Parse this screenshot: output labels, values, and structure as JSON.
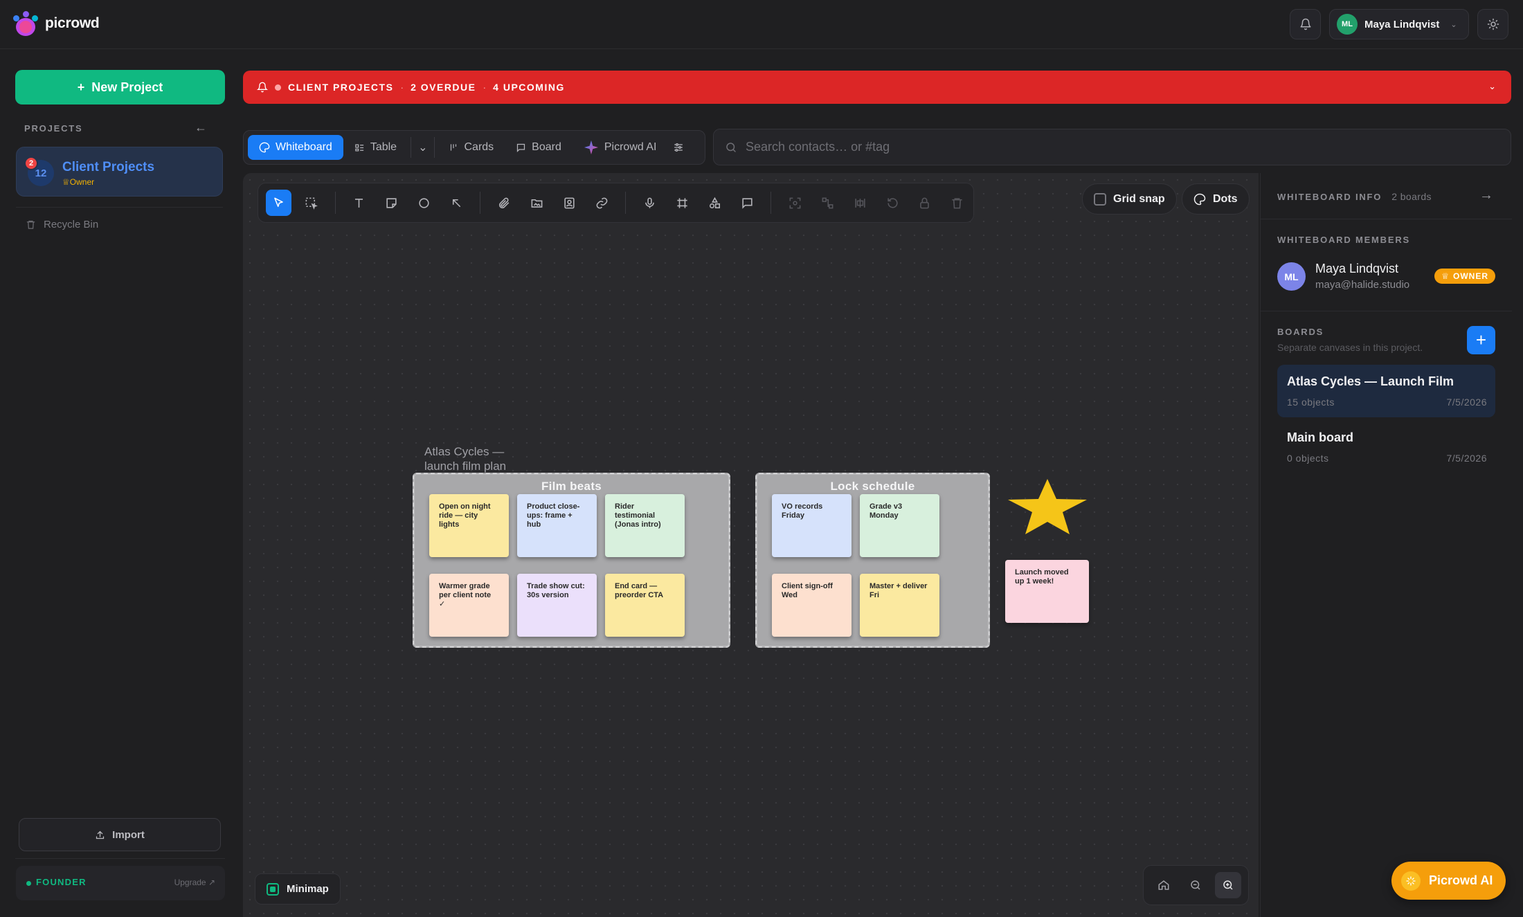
{
  "app": {
    "name": "picrowd"
  },
  "header": {
    "user_initials": "ML",
    "user_name": "Maya Lindqvist"
  },
  "sidebar": {
    "new_project_label": "New Project",
    "projects_label": "PROJECTS",
    "project": {
      "name": "Client Projects",
      "role": "Owner",
      "count": "12",
      "badge": "2"
    },
    "recycle_label": "Recycle Bin",
    "import_label": "Import",
    "plan_label": "FOUNDER",
    "upgrade_label": "Upgrade ↗"
  },
  "alert": {
    "project": "CLIENT PROJECTS",
    "overdue": "2 OVERDUE",
    "upcoming": "4 UPCOMING"
  },
  "views": {
    "tabs": [
      "Whiteboard",
      "Table",
      "Cards",
      "Board",
      "Picrowd AI"
    ],
    "active": "Whiteboard"
  },
  "search": {
    "placeholder": "Search contacts… or #tag"
  },
  "canvas": {
    "grid_snap_label": "Grid snap",
    "dots_label": "Dots",
    "minimap_label": "Minimap",
    "board_title": "Atlas Cycles — launch film plan",
    "frames": [
      {
        "title": "Film beats",
        "notes": [
          {
            "text": "Open on night ride — city lights",
            "color": "#fbe9a0"
          },
          {
            "text": "Product close-ups: frame + hub",
            "color": "#d6e2fb"
          },
          {
            "text": "Rider testimonial (Jonas intro)",
            "color": "#d8f0dd"
          },
          {
            "text": "Warmer grade per client note ✓",
            "color": "#fde0cf"
          },
          {
            "text": "Trade show cut: 30s version",
            "color": "#ebe0fb"
          },
          {
            "text": "End card — preorder CTA",
            "color": "#fbe9a0"
          }
        ]
      },
      {
        "title": "Lock schedule",
        "notes": [
          {
            "text": "VO records Friday",
            "color": "#d6e2fb"
          },
          {
            "text": "Grade v3 Monday",
            "color": "#d8f0dd"
          },
          {
            "text": "Client sign-off Wed",
            "color": "#fde0cf"
          },
          {
            "text": "Master + deliver Fri",
            "color": "#fbe9a0"
          }
        ]
      }
    ],
    "loose_note": {
      "text": "Launch moved up 1 week!",
      "color": "#fbd5df"
    },
    "star_color": "#f5c518"
  },
  "panel": {
    "info_label": "WHITEBOARD INFO",
    "info_count": "2 boards",
    "members_label": "WHITEBOARD MEMBERS",
    "member": {
      "initials": "ML",
      "name": "Maya Lindqvist",
      "email": "maya@halide.studio",
      "role": "OWNER"
    },
    "boards_label": "BOARDS",
    "boards_sub": "Separate canvases in this project.",
    "boards": [
      {
        "name": "Atlas Cycles — Launch Film",
        "count": "15 objects",
        "date": "7/5/2026"
      },
      {
        "name": "Main board",
        "count": "0 objects",
        "date": "7/5/2026"
      }
    ]
  },
  "ai_button_label": "Picrowd AI",
  "colors": {
    "accent": "#1a7cf5",
    "success": "#10b981",
    "danger": "#dc2626",
    "warning": "#f59e0b"
  }
}
